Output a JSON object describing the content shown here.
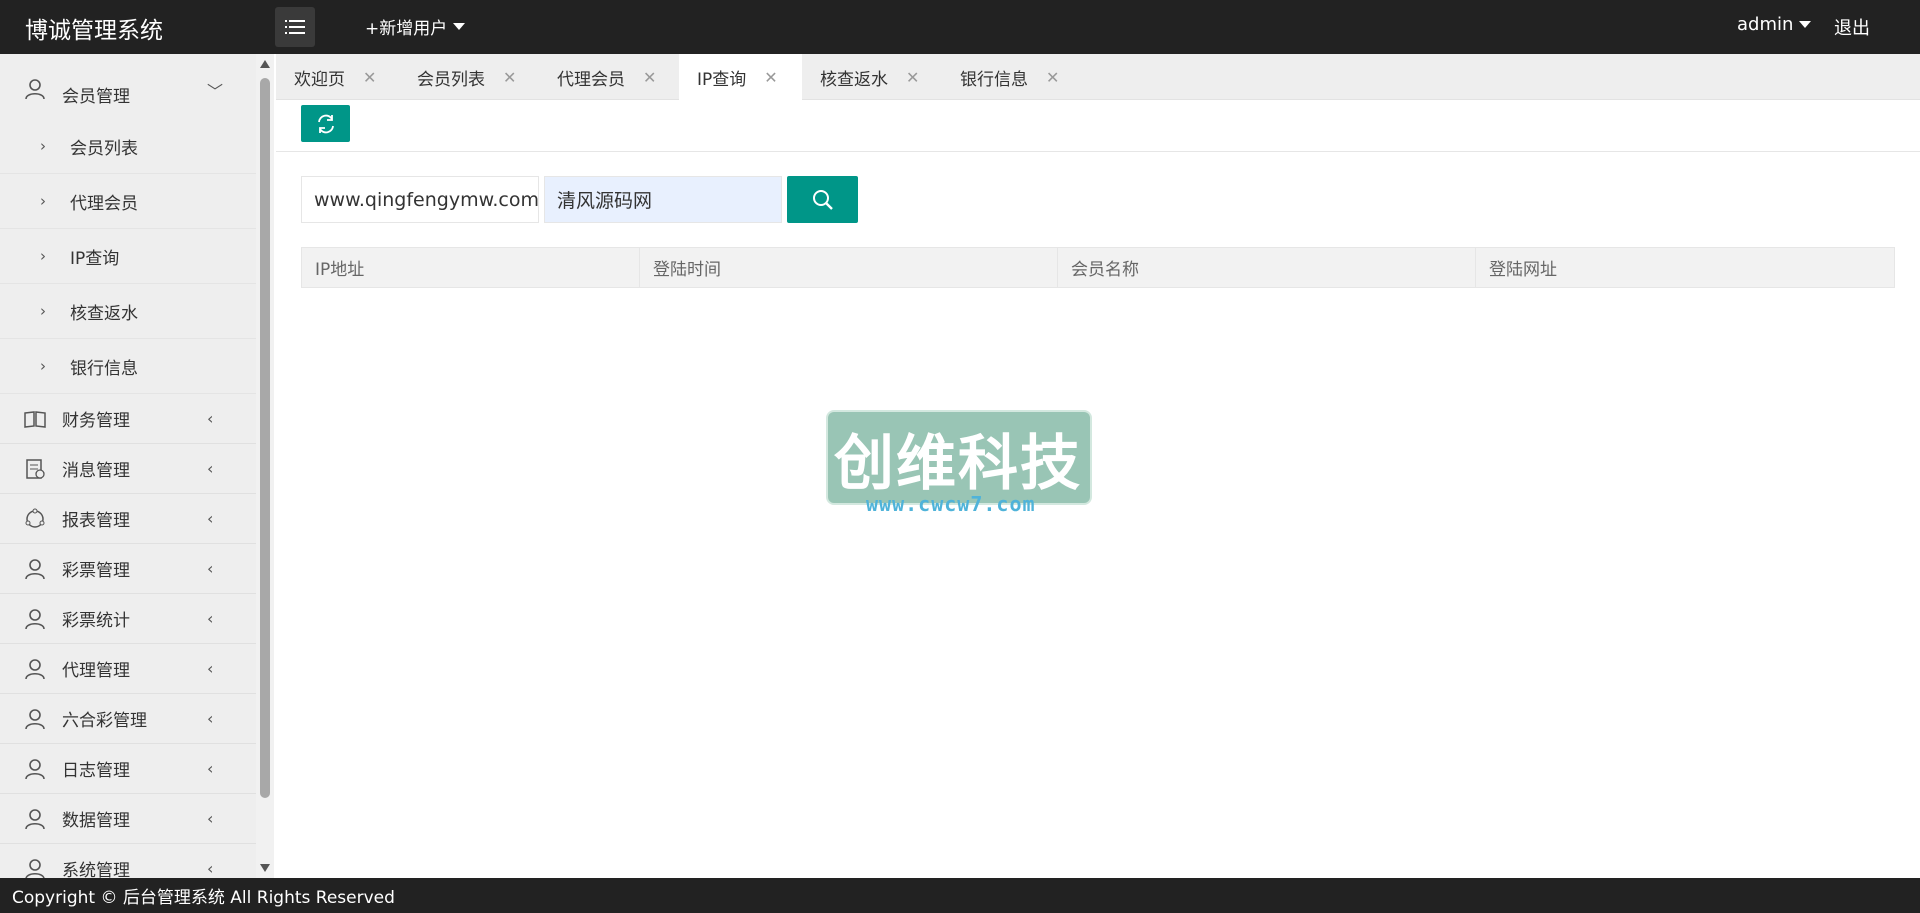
{
  "header": {
    "logo": "博诚管理系统",
    "add_user": "+新增用户",
    "admin": "admin",
    "logout": "退出"
  },
  "sidebar": {
    "groups": [
      {
        "label": "会员管理",
        "expanded": true,
        "icon": "user-icon",
        "children": [
          "会员列表",
          "代理会员",
          "IP查询",
          "核查返水",
          "银行信息"
        ]
      },
      {
        "label": "财务管理",
        "icon": "book-icon"
      },
      {
        "label": "消息管理",
        "icon": "message-icon"
      },
      {
        "label": "报表管理",
        "icon": "report-icon"
      },
      {
        "label": "彩票管理",
        "icon": "user-icon"
      },
      {
        "label": "彩票统计",
        "icon": "user-icon"
      },
      {
        "label": "代理管理",
        "icon": "user-icon"
      },
      {
        "label": "六合彩管理",
        "icon": "user-icon"
      },
      {
        "label": "日志管理",
        "icon": "user-icon"
      },
      {
        "label": "数据管理",
        "icon": "user-icon"
      },
      {
        "label": "系统管理",
        "icon": "user-icon"
      }
    ]
  },
  "tabs": [
    {
      "label": "欢迎页"
    },
    {
      "label": "会员列表"
    },
    {
      "label": "代理会员"
    },
    {
      "label": "IP查询",
      "active": true
    },
    {
      "label": "核查返水"
    },
    {
      "label": "银行信息"
    }
  ],
  "search": {
    "field1_value": "www.qingfengymw.com",
    "field2_value": "清风源码网"
  },
  "table": {
    "columns": [
      "IP地址",
      "登陆时间",
      "会员名称",
      "登陆网址"
    ]
  },
  "watermark": {
    "text": "创维科技",
    "url": "www.cwcw7.com"
  },
  "footer": {
    "text": "Copyright © 后台管理系统 All Rights Reserved"
  },
  "colors": {
    "accent": "#009688",
    "header_bg": "#222222",
    "sidebar_bg": "#eeeeee"
  }
}
